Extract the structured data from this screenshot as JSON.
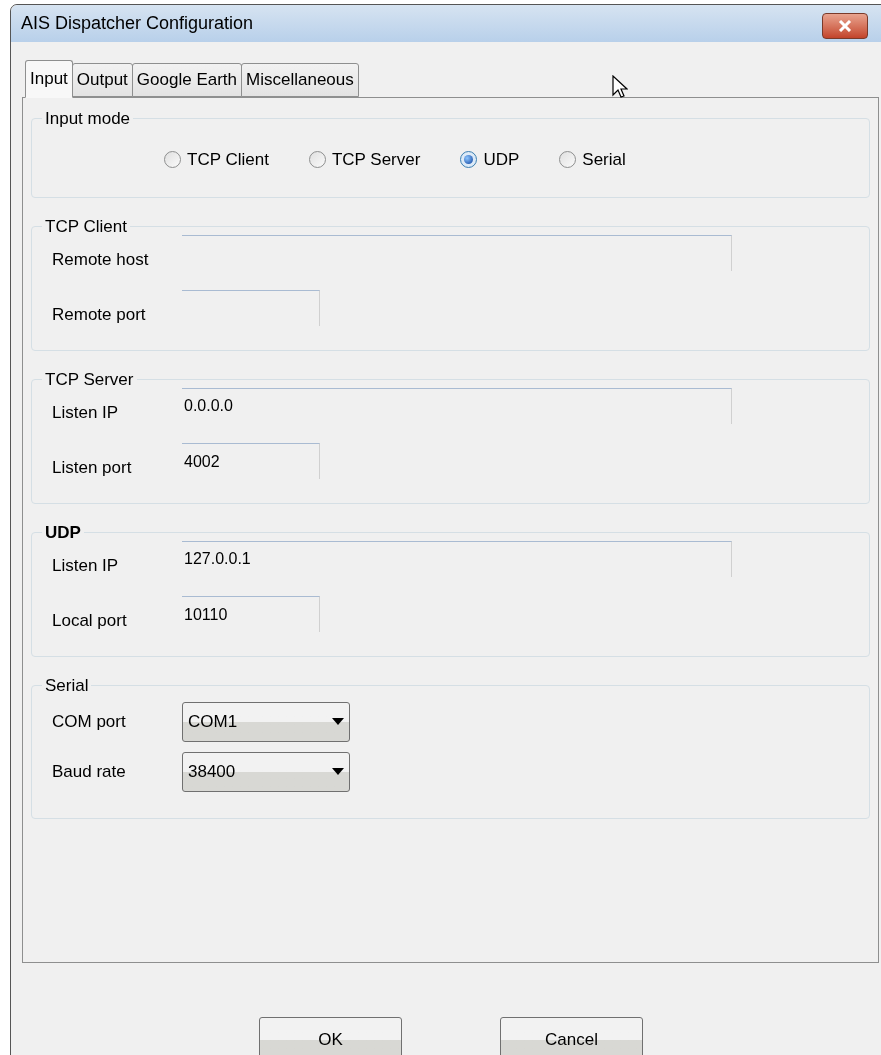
{
  "window": {
    "title": "AIS Dispatcher Configuration"
  },
  "tabs": [
    {
      "label": "Input",
      "selected": true
    },
    {
      "label": "Output",
      "selected": false
    },
    {
      "label": "Google Earth",
      "selected": false
    },
    {
      "label": "Miscellaneous",
      "selected": false
    }
  ],
  "groups": [
    {
      "kind": "radios",
      "title": "Input mode",
      "bold": false,
      "options": [
        {
          "label": "TCP Client",
          "selected": false
        },
        {
          "label": "TCP Server",
          "selected": false
        },
        {
          "label": "UDP",
          "selected": true
        },
        {
          "label": "Serial",
          "selected": false
        }
      ]
    },
    {
      "kind": "fields",
      "title": "TCP Client",
      "bold": false,
      "fields": [
        {
          "label": "Remote host",
          "wide": true
        },
        {
          "label": "Remote port",
          "wide": false
        }
      ]
    },
    {
      "kind": "fields",
      "title": "TCP Server",
      "bold": false,
      "fields": [
        {
          "label": "Listen IP",
          "value": "0.0.0.0",
          "wide": true
        },
        {
          "label": "Listen port",
          "value": "4002",
          "wide": false
        }
      ]
    },
    {
      "kind": "fields",
      "title": "UDP",
      "bold": true,
      "fields": [
        {
          "label": "Listen IP",
          "value": "127.0.0.1",
          "wide": true
        },
        {
          "label": "Local port",
          "value": "10110",
          "wide": false
        }
      ]
    },
    {
      "kind": "selects",
      "title": "Serial",
      "bold": false,
      "fields": [
        {
          "label": "COM port",
          "value": "COM1"
        },
        {
          "label": "Baud rate",
          "value": "38400"
        }
      ]
    }
  ],
  "buttons": [
    "OK",
    "Cancel"
  ]
}
